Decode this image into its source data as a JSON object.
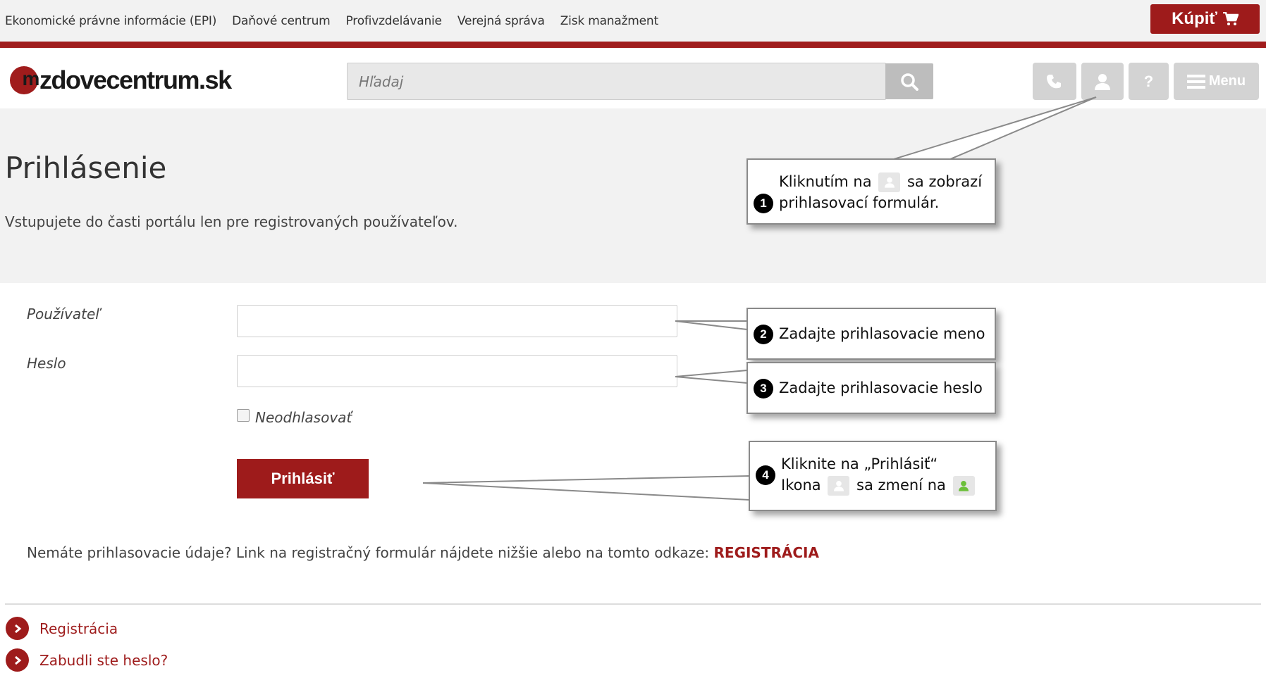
{
  "topnav": {
    "links": [
      "Ekonomické právne informácie (EPI)",
      "Daňové centrum",
      "Profivzdelávanie",
      "Verejná správa",
      "Zisk manažment"
    ],
    "buy_label": "Kúpiť"
  },
  "header": {
    "logo_text": "zdovecentrum.sk",
    "logo_mark": "m",
    "search_placeholder": "Hľadaj",
    "menu_label": "Menu",
    "help_label": "?"
  },
  "page": {
    "title": "Prihlásenie",
    "intro": "Vstupujete do časti portálu len pre registrovaných používateľov."
  },
  "form": {
    "user_label": "Používateľ",
    "user_value": "",
    "password_label": "Heslo",
    "password_value": "",
    "remember_label": "Neodhlasovať",
    "submit_label": "Prihlásiť"
  },
  "registration_note": {
    "text": "Nemáte prihlasovacie údaje? Link na registračný formulár nájdete nižšie alebo na tomto odkaze: ",
    "link": "REGISTRÁCIA"
  },
  "links": [
    "Registrácia",
    "Zabudli ste heslo?"
  ],
  "callouts": [
    {
      "num": "1",
      "part1": "Kliknutím na",
      "part2": "sa zobrazí",
      "line2": "prihlasovací formulár."
    },
    {
      "num": "2",
      "text": "Zadajte prihlasovacie meno"
    },
    {
      "num": "3",
      "text": "Zadajte prihlasovacie heslo"
    },
    {
      "num": "4",
      "line1": "Kliknite na „Prihlásiť“",
      "part1": "Ikona",
      "part2": "sa zmení na"
    }
  ],
  "colors": {
    "brand_red": "#9e1b1b",
    "header_grey": "#f2f2f2",
    "logged_in_green": "#6cbf3a"
  },
  "icons": [
    "cart-icon",
    "search-icon",
    "phone-icon",
    "user-icon",
    "help-icon",
    "menu-icon",
    "chevron-right-icon"
  ]
}
